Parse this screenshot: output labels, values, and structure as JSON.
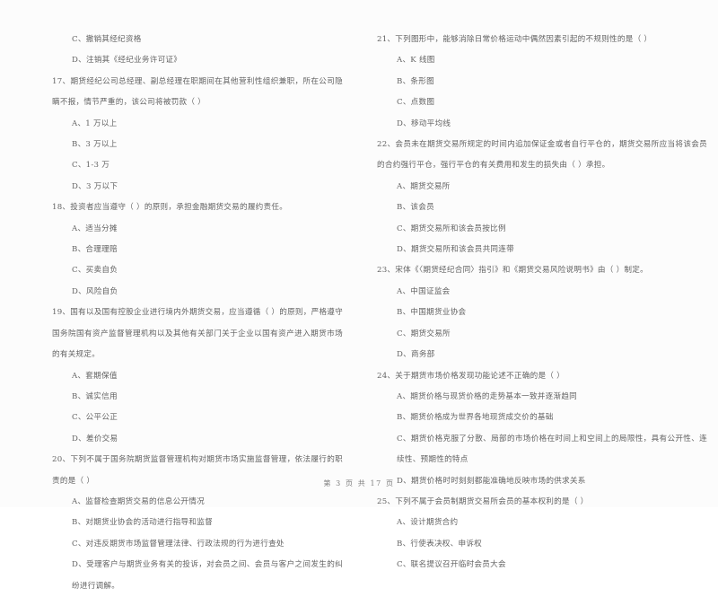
{
  "document": {
    "type": "scanned-exam-paper",
    "footer": "第 3 页 共 17 页",
    "text_color": "#4c4c4c",
    "background_color": "#fefefe"
  },
  "left_column": {
    "orphan_options": [
      {
        "id": "q16-c",
        "text": "C、撤销其经纪资格"
      },
      {
        "id": "q16-d",
        "text": "D、注销其《经纪业务许可证》"
      }
    ],
    "questions": [
      {
        "number": "17",
        "stem": "17、期货经纪公司总经理、副总经理在职期间在其他营利性组织兼职，所在公司隐瞒不报，情节严重的，该公司将被罚款（      ）",
        "options": [
          "A、1 万以上",
          "B、3 万以上",
          "C、1-3 万",
          "D、3 万以下"
        ]
      },
      {
        "number": "18",
        "stem": "18、投资者应当遵守（      ）的原则，承担金融期货交易的履约责任。",
        "options": [
          "A、适当分摊",
          "B、合理理赔",
          "C、买卖自负",
          "D、风险自负"
        ]
      },
      {
        "number": "19",
        "stem": "19、国有以及国有控股企业进行境内外期货交易，应当遵循（      ）的原则，严格遵守国务院国有资产监督管理机构以及其他有关部门关于企业以国有资产进入期货市场的有关规定。",
        "options": [
          "A、套期保值",
          "B、诚实信用",
          "C、公平公正",
          "D、差价交易"
        ]
      },
      {
        "number": "20",
        "stem": "20、下列不属于国务院期货监督管理机构对期货市场实施监督管理，依法履行的职责的是（      ）",
        "options": [
          "A、监督检查期货交易的信息公开情况",
          "B、对期货业协会的活动进行指导和监督",
          "C、对违反期货市场监督管理法律、行政法规的行为进行查处",
          "D、受理客户与期货业务有关的投诉，对会员之间、会员与客户之间发生的纠纷进行调解。"
        ]
      }
    ]
  },
  "right_column": {
    "questions": [
      {
        "number": "21",
        "stem": "21、下列图形中，能够消除日常价格运动中偶然因素引起的不规则性的是（      ）",
        "options": [
          "A、K 线图",
          "B、条形图",
          "C、点数图",
          "D、移动平均线"
        ]
      },
      {
        "number": "22",
        "stem": "22、会员未在期货交易所规定的时间内追加保证金或者自行平仓的，期货交易所应当将该会员的合约强行平仓，强行平仓的有关费用和发生的损失由（      ）承担。",
        "options": [
          "A、期货交易所",
          "B、该会员",
          "C、期货交易所和该会员按比例",
          "D、期货交易所和该会员共同连带"
        ]
      },
      {
        "number": "23",
        "stem": "23、宋体《〈期货经纪合同〉指引》和《期货交易风险说明书》由（      ）制定。",
        "options": [
          "A、中国证监会",
          "B、中国期货业协会",
          "C、期货交易所",
          "D、商务部"
        ]
      },
      {
        "number": "24",
        "stem": "24、关于期货市场价格发现功能论述不正确的是（      ）",
        "options": [
          "A、期货价格与现货价格的走势基本一致并逐渐趋同",
          "B、期货价格成为世界各地现货成交价的基础",
          "C、期货价格克服了分散、局部的市场价格在时间上和空间上的局限性，具有公开性、连续性、预期性的特点",
          "D、期货价格时时刻刻都能准确地反映市场的供求关系"
        ]
      },
      {
        "number": "25",
        "stem": "25、下列不属于会员制期货交易所会员的基本权利的是（      ）",
        "options": [
          "A、设计期货合约",
          "B、行使表决权、申诉权",
          "C、联名提议召开临时会员大会"
        ]
      }
    ]
  }
}
